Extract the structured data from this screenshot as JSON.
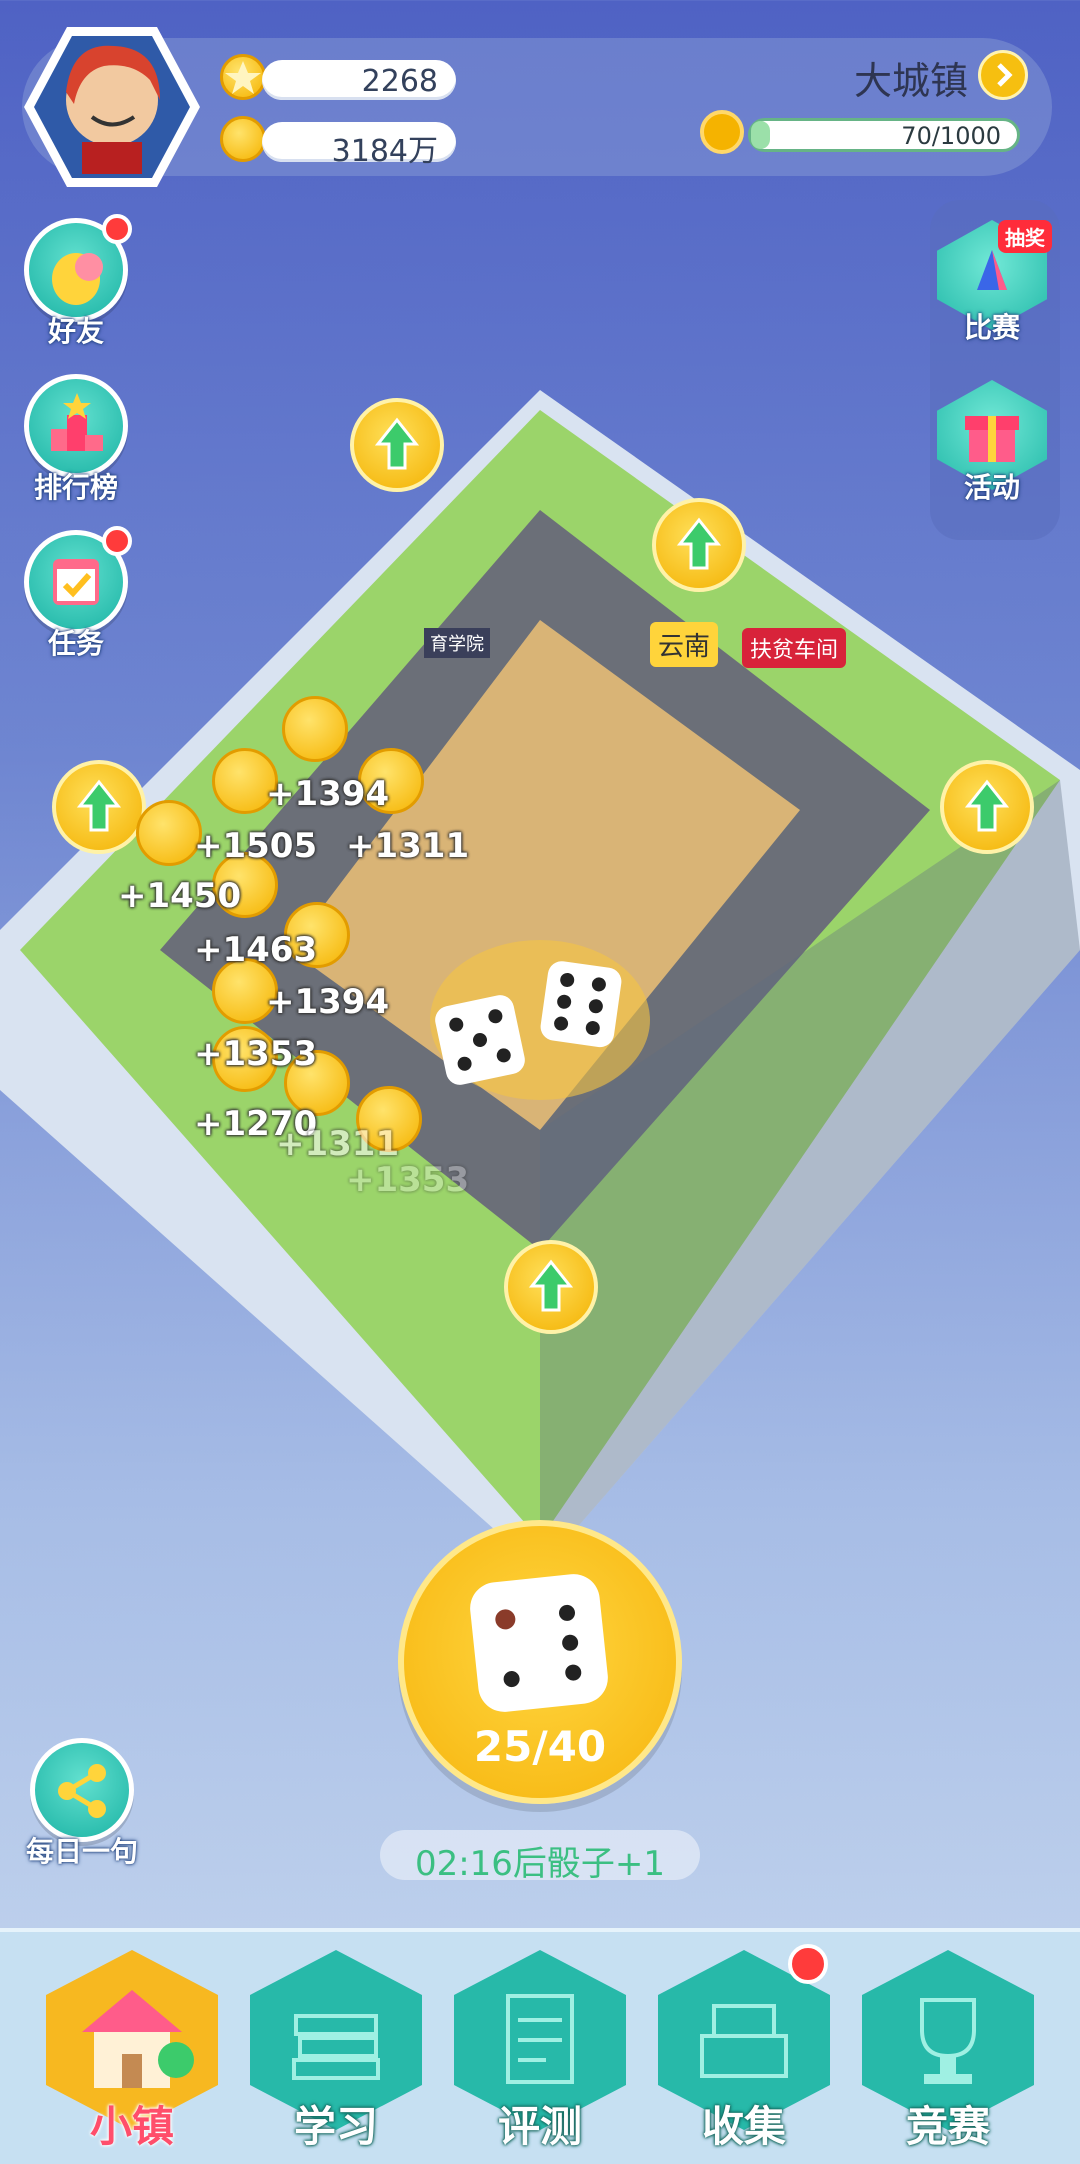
{
  "header": {
    "stars": "2268",
    "coins": "3184万",
    "town_name": "大城镇",
    "progress_text": "70/1000",
    "progress_fraction": 0.07
  },
  "left_menu": [
    {
      "label": "好友",
      "icon": "chick-icon",
      "dot": true
    },
    {
      "label": "排行榜",
      "icon": "podium-icon",
      "dot": false
    },
    {
      "label": "任务",
      "icon": "calendar-check-icon",
      "dot": true
    }
  ],
  "right_menu": [
    {
      "label": "比赛",
      "icon": "flag-icon",
      "badge": "抽奖"
    },
    {
      "label": "活动",
      "icon": "gift-icon",
      "badge": ""
    }
  ],
  "board": {
    "building_signs": [
      "育学院",
      "云南",
      "扶贫车间"
    ],
    "coin_popups": [
      "+1394",
      "+1505",
      "+1311",
      "+1450",
      "+1463",
      "+1394",
      "+1353",
      "+1270",
      "+1311",
      "+1353"
    ],
    "dice": [
      5,
      6
    ]
  },
  "roll": {
    "count": "25/40"
  },
  "timer": "02:16后骰子+1",
  "daily": {
    "label": "每日一句"
  },
  "nav": [
    {
      "label": "小镇",
      "icon": "house-icon",
      "active": true,
      "dot": false
    },
    {
      "label": "学习",
      "icon": "books-icon",
      "active": false,
      "dot": false
    },
    {
      "label": "评测",
      "icon": "exam-paper-icon",
      "active": false,
      "dot": false
    },
    {
      "label": "收集",
      "icon": "collection-box-icon",
      "active": false,
      "dot": true
    },
    {
      "label": "竞赛",
      "icon": "trophy-icon",
      "active": false,
      "dot": false
    }
  ],
  "colors": {
    "accent": "#f6b40c",
    "teal": "#27b9a9",
    "alert": "#ff3b3b"
  }
}
